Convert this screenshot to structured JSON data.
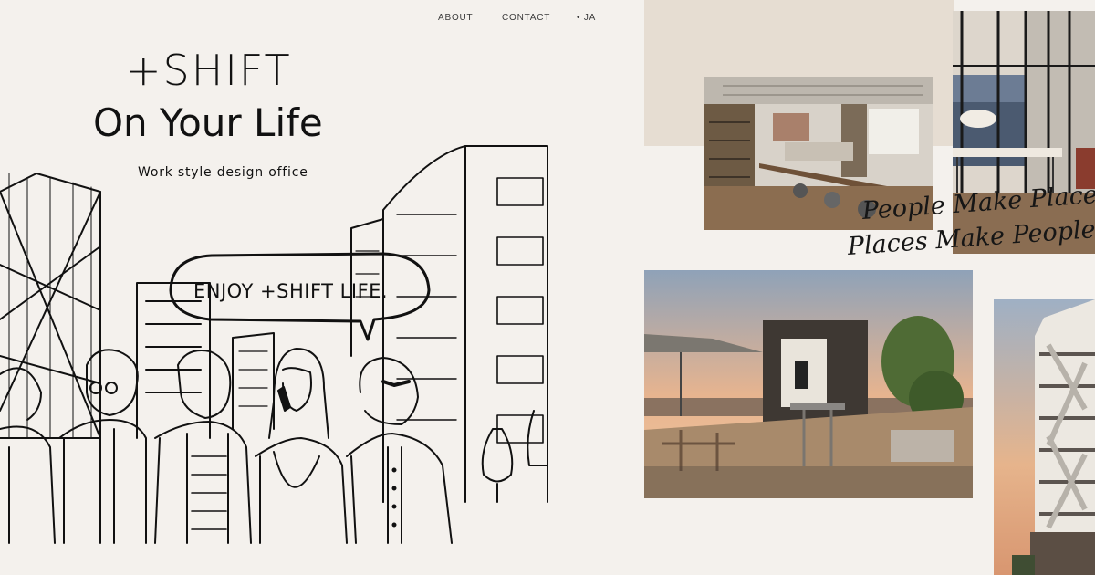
{
  "nav": {
    "about": "ABOUT",
    "contact": "CONTACT",
    "lang": "•  JA"
  },
  "hero": {
    "logo_line1": "+SHIFT",
    "logo_line2": "On Your Life",
    "tagline": "Work style design office",
    "speech_bubble": "ENJOY +SHIFT LIFE."
  },
  "motto": {
    "line1": "People Make Places.",
    "line2": "Places Make People."
  },
  "colors": {
    "background": "#f4f1ed",
    "panel_beige": "#e6ddd2",
    "ink": "#111111"
  },
  "images": {
    "office": "office-interior-photo",
    "meeting": "glass-meeting-room-photo",
    "terrace": "rooftop-terrace-photo",
    "building": "building-exterior-photo"
  }
}
